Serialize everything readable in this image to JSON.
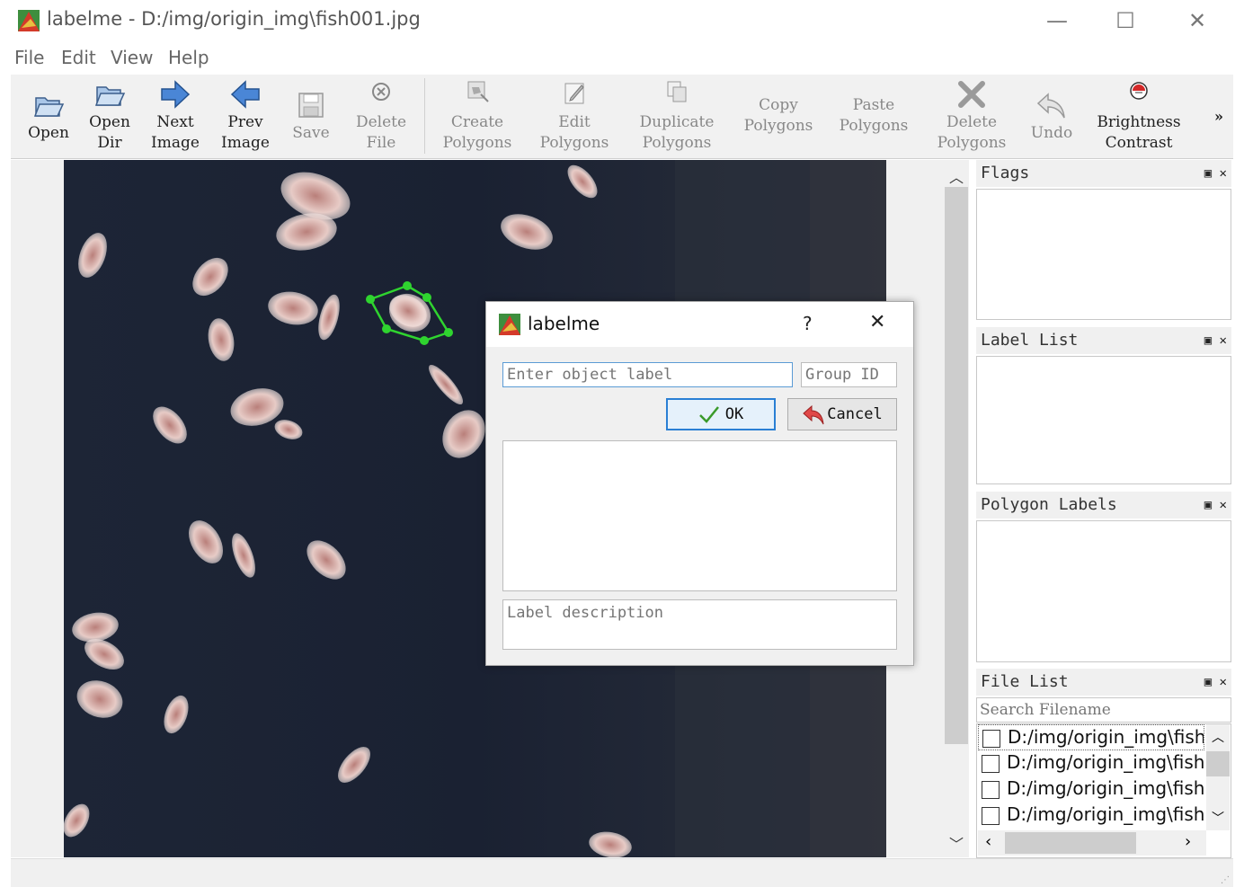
{
  "window": {
    "title": "labelme - D:/img/origin_img\\fish001.jpg",
    "min_glyph": "—",
    "max_glyph": "☐",
    "close_glyph": "✕"
  },
  "menu": [
    "File",
    "Edit",
    "View",
    "Help"
  ],
  "toolbar": {
    "open": "Open",
    "open_dir": "Open\nDir",
    "next_image": "Next\nImage",
    "prev_image": "Prev\nImage",
    "save": "Save",
    "delete_file": "Delete\nFile",
    "create_polygons": "Create\nPolygons",
    "edit_polygons": "Edit\nPolygons",
    "duplicate_polygons": "Duplicate\nPolygons",
    "copy_polygons": "Copy\nPolygons",
    "paste_polygons": "Paste\nPolygons",
    "delete_polygons": "Delete\nPolygons",
    "undo": "Undo",
    "brightness_contrast": "Brightness\nContrast",
    "overflow": "»"
  },
  "docks": {
    "flags": "Flags",
    "label_list": "Label List",
    "polygon_labels": "Polygon Labels",
    "file_list": "File List",
    "search_placeholder": "Search Filename",
    "files": [
      "D:/img/origin_img\\fish",
      "D:/img/origin_img\\fish",
      "D:/img/origin_img\\fish",
      "D:/img/origin_img\\fish"
    ]
  },
  "dialog": {
    "title": "labelme",
    "help_glyph": "?",
    "close_glyph": "✕",
    "label_placeholder": "Enter object label",
    "group_placeholder": "Group ID",
    "ok": "OK",
    "cancel": "Cancel",
    "description_placeholder": "Label description"
  },
  "colors": {
    "polygon": "#2fd42f",
    "photo_background": "#1b2233",
    "fish": "#d8b3ac",
    "ok_border": "#2a7fd4"
  }
}
